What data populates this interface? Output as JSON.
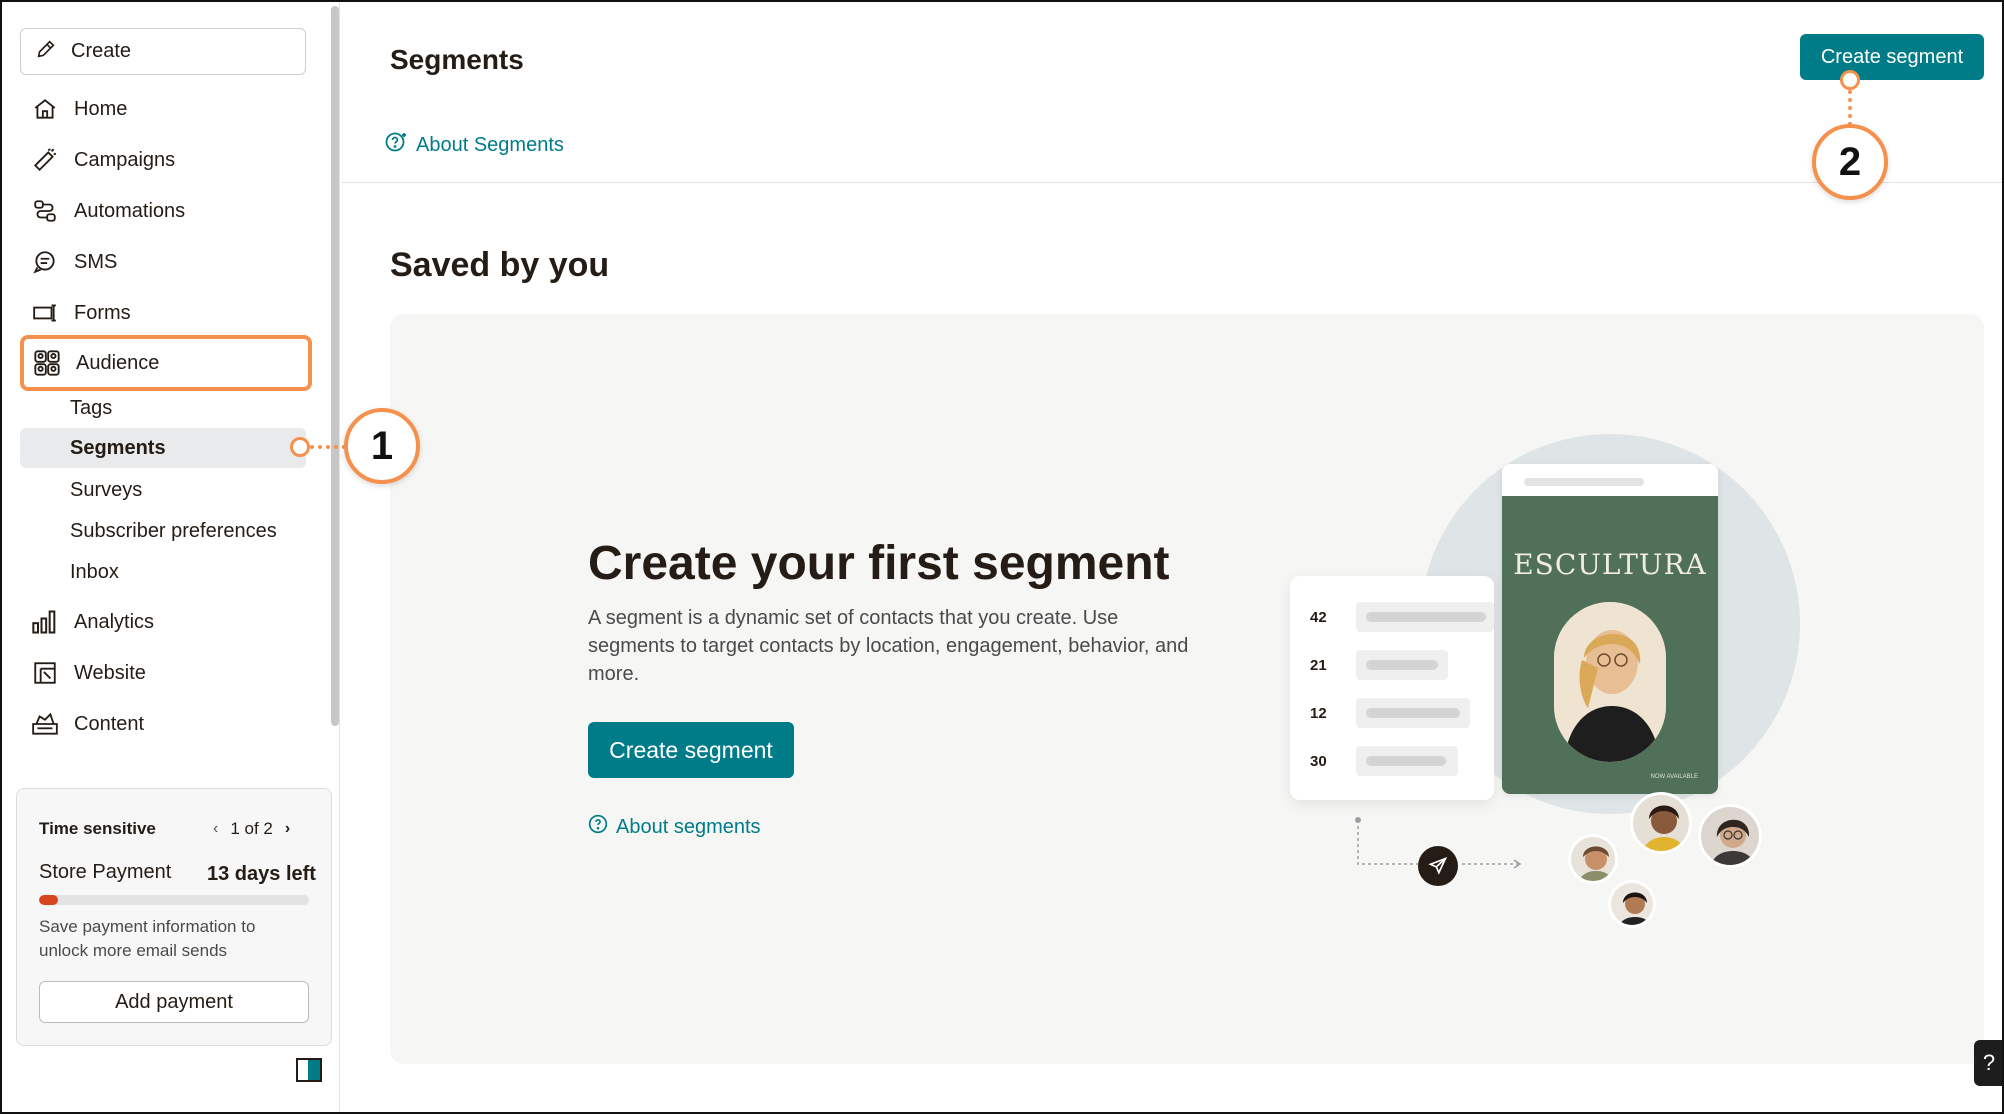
{
  "sidebar": {
    "create_label": "Create",
    "nav": [
      {
        "label": "Home",
        "icon": "home-icon"
      },
      {
        "label": "Campaigns",
        "icon": "megaphone-icon"
      },
      {
        "label": "Automations",
        "icon": "automations-icon"
      },
      {
        "label": "SMS",
        "icon": "sms-icon"
      },
      {
        "label": "Forms",
        "icon": "forms-icon"
      },
      {
        "label": "Audience",
        "icon": "audience-icon"
      }
    ],
    "audience_sub": [
      "Tags",
      "Segments",
      "Surveys",
      "Subscriber preferences",
      "Inbox"
    ],
    "nav_bottom": [
      {
        "label": "Analytics",
        "icon": "analytics-icon"
      },
      {
        "label": "Website",
        "icon": "website-icon"
      },
      {
        "label": "Content",
        "icon": "content-icon"
      }
    ],
    "time_sensitive": {
      "title": "Time sensitive",
      "pager": "1 of 2",
      "item": "Store Payment",
      "days_left": "13 days left",
      "progress": 0.07,
      "description": "Save payment information to unlock more email sends",
      "button": "Add payment"
    }
  },
  "header": {
    "title": "Segments",
    "about_link": "About Segments",
    "create_button": "Create segment"
  },
  "main": {
    "section_title": "Saved by you",
    "empty": {
      "heading": "Create your first segment",
      "description": "A segment is a dynamic set of contacts that you create. Use segments to target contacts by location, engagement, behavior, and more.",
      "button": "Create segment",
      "about_link": "About segments"
    },
    "illustration": {
      "brand": "ESCULTURA",
      "stats": [
        "42",
        "21",
        "12",
        "30"
      ],
      "phone_foot_right": "NOW AVAILABLE"
    }
  },
  "callouts": [
    "1",
    "2"
  ],
  "help_label": "?",
  "colors": {
    "accent": "#007c89",
    "callout": "#f5914d",
    "progress": "#d7461c"
  }
}
